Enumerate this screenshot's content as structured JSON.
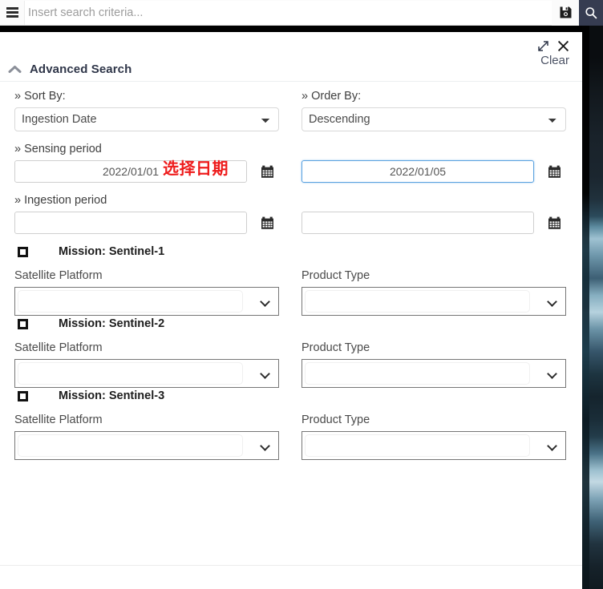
{
  "topbar": {
    "menu_icon": "hamburger-icon",
    "search_placeholder": "Insert search criteria...",
    "search_value": "",
    "save_icon": "save-floppy-icon",
    "search_icon": "search-icon",
    "search_button_color": "#363c51"
  },
  "panel": {
    "title": "Advanced Search",
    "collapse_icon": "chevron-up-icon",
    "expand_icon": "expand-arrows-icon",
    "close_icon": "close-x-icon",
    "clear_label": "Clear"
  },
  "annotation": {
    "text": "选择日期",
    "color": "#ee1c1c"
  },
  "form": {
    "sort_by": {
      "label": "» Sort By:",
      "value": "Ingestion Date",
      "options": [
        "Ingestion Date"
      ]
    },
    "order_by": {
      "label": "» Order By:",
      "value": "Descending",
      "options": [
        "Descending"
      ]
    },
    "sensing_period": {
      "label": "» Sensing period",
      "start_value": "2022/01/01",
      "end_value": "2022/01/05",
      "start_placeholder": "",
      "end_placeholder": "",
      "end_focused": true,
      "calendar_icon": "calendar-icon"
    },
    "ingestion_period": {
      "label": "» Ingestion period",
      "start_value": "",
      "end_value": "",
      "start_placeholder": "",
      "end_placeholder": "",
      "calendar_icon": "calendar-icon"
    },
    "missions": [
      {
        "label": "Mission: Sentinel-1",
        "checked": false,
        "platform_label": "Satellite Platform",
        "platform_value": "",
        "product_label": "Product Type",
        "product_value": ""
      },
      {
        "label": "Mission: Sentinel-2",
        "checked": false,
        "platform_label": "Satellite Platform",
        "platform_value": "",
        "product_label": "Product Type",
        "product_value": ""
      },
      {
        "label": "Mission: Sentinel-3",
        "checked": false,
        "platform_label": "Satellite Platform",
        "platform_value": "",
        "product_label": "Product Type",
        "product_value": ""
      }
    ]
  }
}
